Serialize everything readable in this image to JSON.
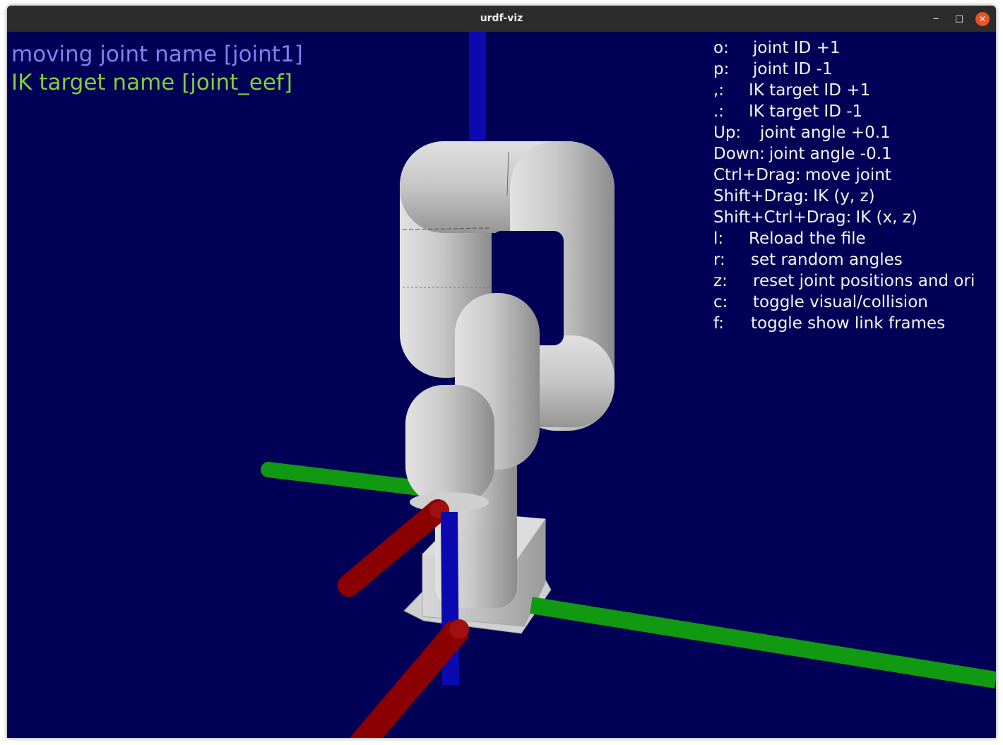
{
  "window": {
    "title": "urdf-viz",
    "minimize_glyph": "‒",
    "maximize_glyph": "□",
    "close_glyph": "✕"
  },
  "status": {
    "moving_joint": "moving joint name [joint1]",
    "ik_target": "IK target name [joint_eef]"
  },
  "help": [
    {
      "key": "o:",
      "text": "joint ID +1"
    },
    {
      "key": "p:",
      "text": "joint ID -1"
    },
    {
      "key": ",:",
      "text": "IK target ID +1"
    },
    {
      "key": ".:",
      "text": "IK target ID -1"
    },
    {
      "key": "Up:",
      "text": "joint angle +0.1"
    },
    {
      "key": "Down:",
      "text": "joint angle -0.1"
    },
    {
      "key": "Ctrl+Drag:",
      "text": "move joint"
    },
    {
      "key": "Shift+Drag:",
      "text": "IK (y, z)"
    },
    {
      "key": "Shift+Ctrl+Drag:",
      "text": "IK (x, z)"
    },
    {
      "key": "l:",
      "text": "Reload the file"
    },
    {
      "key": "r:",
      "text": "set random angles"
    },
    {
      "key": "z:",
      "text": "reset joint positions and ori"
    },
    {
      "key": "c:",
      "text": "toggle visual/collision"
    },
    {
      "key": "f:",
      "text": "toggle show link frames"
    }
  ],
  "colors": {
    "background": "#000056",
    "status_joint": "#8080f0",
    "status_ik": "#7fcf3a",
    "help_text": "#f4f4f4",
    "axis_x": "#8b0000",
    "axis_y": "#119911",
    "axis_z": "#0a0ab0",
    "robot": "#c4c4c4"
  }
}
